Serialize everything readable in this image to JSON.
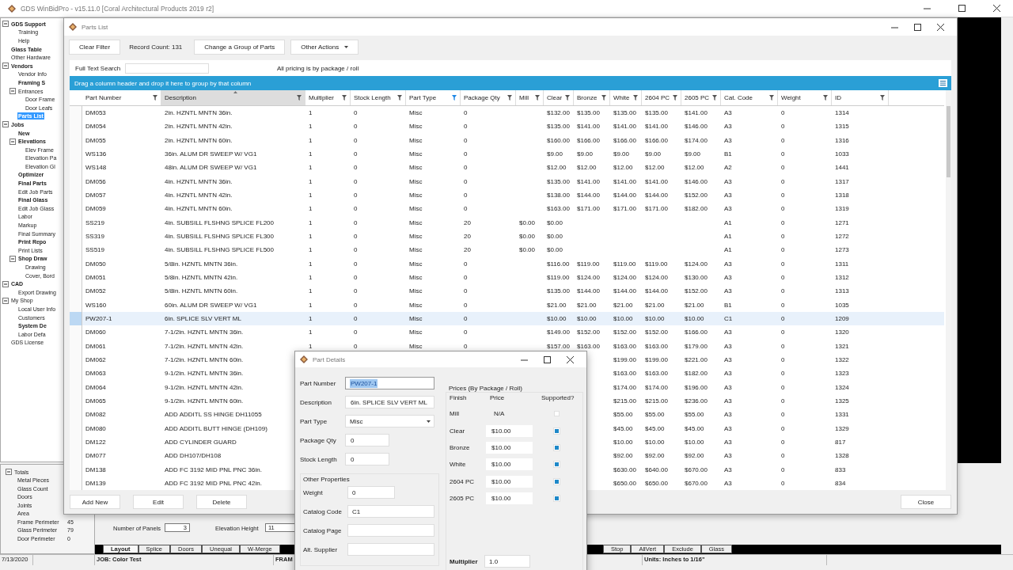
{
  "main_window": {
    "title": "GDS WinBidPro - v15.11.0 [Coral Architectural Products 2019 r2]"
  },
  "nav_tree": [
    {
      "label": "GDS Support",
      "bold": true,
      "selected": false,
      "expanded": true,
      "children": [
        {
          "label": "Training",
          "bold": false,
          "selected": false
        },
        {
          "label": "Help",
          "bold": false,
          "selected": false
        }
      ]
    },
    {
      "label": "Glass Table",
      "bold": true,
      "selected": false
    },
    {
      "label": "Other Hardware",
      "bold": false,
      "selected": false
    },
    {
      "label": "Vendors",
      "bold": true,
      "selected": false,
      "expanded": true,
      "children": [
        {
          "label": "Vendor Info",
          "bold": false,
          "selected": false
        },
        {
          "label": "Framing S",
          "bold": true,
          "selected": false
        },
        {
          "label": "Entrances",
          "bold": false,
          "selected": false,
          "expanded": true,
          "children": [
            {
              "label": "Door Frame",
              "bold": false,
              "selected": false
            },
            {
              "label": "Door Leafs",
              "bold": false,
              "selected": false
            }
          ]
        },
        {
          "label": "Parts List",
          "bold": true,
          "selected": true
        }
      ]
    },
    {
      "label": "Jobs",
      "bold": true,
      "selected": false,
      "expanded": true,
      "children": [
        {
          "label": "New",
          "bold": true,
          "selected": false
        },
        {
          "label": "Elevations",
          "bold": true,
          "selected": false,
          "expanded": true,
          "children": [
            {
              "label": "Elev Frame",
              "bold": false,
              "selected": false
            },
            {
              "label": "Elevation Pa",
              "bold": false,
              "selected": false
            },
            {
              "label": "Elevation Gl",
              "bold": false,
              "selected": false
            }
          ]
        },
        {
          "label": "Optimizer",
          "bold": true,
          "selected": false
        },
        {
          "label": "Final Parts",
          "bold": true,
          "selected": false
        },
        {
          "label": "Edit Job Parts",
          "bold": false,
          "selected": false
        },
        {
          "label": "Final Glass",
          "bold": true,
          "selected": false
        },
        {
          "label": "Edit Job Glass",
          "bold": false,
          "selected": false
        },
        {
          "label": "Labor",
          "bold": false,
          "selected": false
        },
        {
          "label": "Markup",
          "bold": false,
          "selected": false
        },
        {
          "label": "Final Summary",
          "bold": false,
          "selected": false
        },
        {
          "label": "Print Repo",
          "bold": true,
          "selected": false
        },
        {
          "label": "Print Lists",
          "bold": false,
          "selected": false
        },
        {
          "label": "Shop Draw",
          "bold": true,
          "selected": false,
          "expanded": true,
          "children": [
            {
              "label": "Drawing",
              "bold": false,
              "selected": false
            },
            {
              "label": "Cover, Bord",
              "bold": false,
              "selected": false
            }
          ]
        }
      ]
    },
    {
      "label": "CAD",
      "bold": true,
      "selected": false,
      "expanded": true,
      "children": [
        {
          "label": "Export Drawing",
          "bold": false,
          "selected": false
        }
      ]
    },
    {
      "label": "My Shop",
      "bold": false,
      "selected": false,
      "expanded": true,
      "children": [
        {
          "label": "Local User Info",
          "bold": false,
          "selected": false
        },
        {
          "label": "Customers",
          "bold": false,
          "selected": false
        },
        {
          "label": "System De",
          "bold": true,
          "selected": false
        },
        {
          "label": "Labor Defa",
          "bold": false,
          "selected": false
        }
      ]
    },
    {
      "label": "GDS License",
      "bold": false,
      "selected": false
    }
  ],
  "totals": {
    "label": "Totals",
    "expanded": true,
    "items": [
      {
        "label": "Metal Pieces"
      },
      {
        "label": "Glass Count"
      },
      {
        "label": "Doors"
      },
      {
        "label": "Joints"
      },
      {
        "label": "Area"
      },
      {
        "label": "Frame Perimeter",
        "value": "45"
      },
      {
        "label": "Glass Perimeter",
        "value": "79"
      },
      {
        "label": "Door Perimeter",
        "value": "0"
      }
    ]
  },
  "elevation_props": {
    "panels_label": "Number of Panels",
    "panels_value": "3",
    "height_label": "Elevation Height",
    "height_value": "11"
  },
  "bottom_tabs": {
    "left": [
      {
        "label": "Layout",
        "selected": true
      },
      {
        "label": "Splice",
        "selected": false
      },
      {
        "label": "Doors",
        "selected": false
      },
      {
        "label": "Unequal",
        "selected": false
      },
      {
        "label": "W-Merge",
        "selected": false
      }
    ],
    "right": [
      {
        "label": "Stop",
        "selected": false
      },
      {
        "label": "AllVert",
        "selected": false
      },
      {
        "label": "Exclude",
        "selected": false
      },
      {
        "label": "Glass",
        "selected": false
      }
    ]
  },
  "status_bar": {
    "date": "7/13/2020",
    "job": "JOB: Color Test",
    "frame": "FRAM",
    "units": "Units: Inches to 1/16\""
  },
  "parts_window": {
    "title": "Parts List",
    "toolbar": {
      "clear_filter": "Clear Filter",
      "record_count": "Record Count: 131",
      "change_group": "Change a Group of Parts",
      "other_actions": "Other Actions"
    },
    "search_label": "Full Text Search",
    "pricing_note": "All pricing is by package / roll",
    "group_hint": "Drag a column header and drop it here to group by that column",
    "columns": [
      {
        "label": "Part Number",
        "sorted": false,
        "filter_active": false
      },
      {
        "label": "Description",
        "sorted": true,
        "filter_active": false
      },
      {
        "label": "Multiplier",
        "sorted": false,
        "filter_active": false
      },
      {
        "label": "Stock Length",
        "sorted": false,
        "filter_active": false
      },
      {
        "label": "Part Type",
        "sorted": false,
        "filter_active": true
      },
      {
        "label": "Package Qty",
        "sorted": false,
        "filter_active": false
      },
      {
        "label": "Mill",
        "sorted": false,
        "filter_active": false
      },
      {
        "label": "Clear",
        "sorted": false,
        "filter_active": false
      },
      {
        "label": "Bronze",
        "sorted": false,
        "filter_active": false
      },
      {
        "label": "White",
        "sorted": false,
        "filter_active": false
      },
      {
        "label": "2604 PC",
        "sorted": false,
        "filter_active": false
      },
      {
        "label": "2605 PC",
        "sorted": false,
        "filter_active": false
      },
      {
        "label": "Cat. Code",
        "sorted": false,
        "filter_active": false
      },
      {
        "label": "Weight",
        "sorted": false,
        "filter_active": false
      },
      {
        "label": "ID",
        "sorted": false,
        "filter_active": false
      }
    ],
    "rows": [
      {
        "selected": false,
        "cells": [
          "DM053",
          "2in. HZNTL MNTN 36in.",
          "1",
          "0",
          "Misc",
          "0",
          null,
          "$132.00",
          "$135.00",
          "$135.00",
          "$135.00",
          "$141.00",
          "A3",
          "0",
          "1314"
        ]
      },
      {
        "selected": false,
        "cells": [
          "DM054",
          "2in. HZNTL MNTN 42in.",
          "1",
          "0",
          "Misc",
          "0",
          null,
          "$135.00",
          "$141.00",
          "$141.00",
          "$141.00",
          "$146.00",
          "A3",
          "0",
          "1315"
        ]
      },
      {
        "selected": false,
        "cells": [
          "DM055",
          "2in. HZNTL MNTN 60in.",
          "1",
          "0",
          "Misc",
          "0",
          null,
          "$160.00",
          "$166.00",
          "$166.00",
          "$166.00",
          "$174.00",
          "A3",
          "0",
          "1316"
        ]
      },
      {
        "selected": false,
        "cells": [
          "WS136",
          "36in. ALUM DR SWEEP W/ VG1",
          "1",
          "0",
          "Misc",
          "0",
          null,
          "$9.00",
          "$9.00",
          "$9.00",
          "$9.00",
          "$9.00",
          "B1",
          "0",
          "1033"
        ]
      },
      {
        "selected": false,
        "cells": [
          "WS148",
          "48in. ALUM DR SWEEP W/ VG1",
          "1",
          "0",
          "Misc",
          "0",
          null,
          "$12.00",
          "$12.00",
          "$12.00",
          "$12.00",
          "$12.00",
          "A2",
          "0",
          "1441"
        ]
      },
      {
        "selected": false,
        "cells": [
          "DM056",
          "4in. HZNTL MNTN 36in.",
          "1",
          "0",
          "Misc",
          "0",
          null,
          "$135.00",
          "$141.00",
          "$141.00",
          "$141.00",
          "$146.00",
          "A3",
          "0",
          "1317"
        ]
      },
      {
        "selected": false,
        "cells": [
          "DM057",
          "4in. HZNTL MNTN 42in.",
          "1",
          "0",
          "Misc",
          "0",
          null,
          "$138.00",
          "$144.00",
          "$144.00",
          "$144.00",
          "$152.00",
          "A3",
          "0",
          "1318"
        ]
      },
      {
        "selected": false,
        "cells": [
          "DM059",
          "4in. HZNTL MNTN 60in.",
          "1",
          "0",
          "Misc",
          "0",
          null,
          "$163.00",
          "$171.00",
          "$171.00",
          "$171.00",
          "$182.00",
          "A3",
          "0",
          "1319"
        ]
      },
      {
        "selected": false,
        "cells": [
          "SS219",
          "4in. SUBSILL FLSHNG SPLICE FL200",
          "1",
          "0",
          "Misc",
          "20",
          "$0.00",
          "$0.00",
          null,
          null,
          null,
          null,
          "A1",
          "0",
          "1271"
        ]
      },
      {
        "selected": false,
        "cells": [
          "SS319",
          "4in. SUBSILL FLSHNG SPLICE FL300",
          "1",
          "0",
          "Misc",
          "20",
          "$0.00",
          "$0.00",
          null,
          null,
          null,
          null,
          "A1",
          "0",
          "1272"
        ]
      },
      {
        "selected": false,
        "cells": [
          "SS519",
          "4in. SUBSILL FLSHNG SPLICE FL500",
          "1",
          "0",
          "Misc",
          "20",
          "$0.00",
          "$0.00",
          null,
          null,
          null,
          null,
          "A1",
          "0",
          "1273"
        ]
      },
      {
        "selected": false,
        "cells": [
          "DM050",
          "5/8in. HZNTL MNTN 36in.",
          "1",
          "0",
          "Misc",
          "0",
          null,
          "$116.00",
          "$119.00",
          "$119.00",
          "$119.00",
          "$124.00",
          "A3",
          "0",
          "1311"
        ]
      },
      {
        "selected": false,
        "cells": [
          "DM051",
          "5/8in. HZNTL MNTN 42in.",
          "1",
          "0",
          "Misc",
          "0",
          null,
          "$119.00",
          "$124.00",
          "$124.00",
          "$124.00",
          "$130.00",
          "A3",
          "0",
          "1312"
        ]
      },
      {
        "selected": false,
        "cells": [
          "DM052",
          "5/8in. HZNTL MNTN 60in.",
          "1",
          "0",
          "Misc",
          "0",
          null,
          "$135.00",
          "$144.00",
          "$144.00",
          "$144.00",
          "$152.00",
          "A3",
          "0",
          "1313"
        ]
      },
      {
        "selected": false,
        "cells": [
          "WS160",
          "60in. ALUM DR SWEEP W/ VG1",
          "1",
          "0",
          "Misc",
          "0",
          null,
          "$21.00",
          "$21.00",
          "$21.00",
          "$21.00",
          "$21.00",
          "B1",
          "0",
          "1035"
        ]
      },
      {
        "selected": true,
        "cells": [
          "PW207-1",
          "6in. SPLICE SLV VERT ML",
          "1",
          "0",
          "Misc",
          "0",
          null,
          "$10.00",
          "$10.00",
          "$10.00",
          "$10.00",
          "$10.00",
          "C1",
          "0",
          "1209"
        ]
      },
      {
        "selected": false,
        "cells": [
          "DM060",
          "7-1/2in. HZNTL MNTN 36in.",
          "1",
          "0",
          "Misc",
          "0",
          null,
          "$149.00",
          "$152.00",
          "$152.00",
          "$152.00",
          "$166.00",
          "A3",
          "0",
          "1320"
        ]
      },
      {
        "selected": false,
        "cells": [
          "DM061",
          "7-1/2in. HZNTL MNTN 42in.",
          "1",
          "0",
          "Misc",
          "0",
          null,
          "$157.00",
          "$163.00",
          "$163.00",
          "$163.00",
          "$179.00",
          "A3",
          "0",
          "1321"
        ]
      },
      {
        "selected": false,
        "cells": [
          "DM062",
          "7-1/2in. HZNTL MNTN 60in.",
          null,
          null,
          null,
          null,
          null,
          null,
          null,
          "$199.00",
          "$199.00",
          "$221.00",
          "A3",
          "0",
          "1322"
        ]
      },
      {
        "selected": false,
        "cells": [
          "DM063",
          "9-1/2in. HZNTL MNTN 36in.",
          null,
          null,
          null,
          null,
          null,
          null,
          null,
          "$163.00",
          "$163.00",
          "$182.00",
          "A3",
          "0",
          "1323"
        ]
      },
      {
        "selected": false,
        "cells": [
          "DM064",
          "9-1/2in. HZNTL MNTN 42in.",
          null,
          null,
          null,
          null,
          null,
          null,
          null,
          "$174.00",
          "$174.00",
          "$196.00",
          "A3",
          "0",
          "1324"
        ]
      },
      {
        "selected": false,
        "cells": [
          "DM065",
          "9-1/2in. HZNTL MNTN 60in.",
          null,
          null,
          null,
          null,
          null,
          null,
          null,
          "$215.00",
          "$215.00",
          "$236.00",
          "A3",
          "0",
          "1325"
        ]
      },
      {
        "selected": false,
        "cells": [
          "DM082",
          "ADD ADDITL SS HINGE DH11055",
          null,
          null,
          null,
          null,
          null,
          null,
          null,
          "$55.00",
          "$55.00",
          "$55.00",
          "A3",
          "0",
          "1331"
        ]
      },
      {
        "selected": false,
        "cells": [
          "DM080",
          "ADD ADDITL BUTT HINGE (DH109)",
          null,
          null,
          null,
          null,
          null,
          null,
          null,
          "$45.00",
          "$45.00",
          "$45.00",
          "A3",
          "0",
          "1329"
        ]
      },
      {
        "selected": false,
        "cells": [
          "DM122",
          "ADD CYLINDER GUARD",
          null,
          null,
          null,
          null,
          null,
          null,
          null,
          "$10.00",
          "$10.00",
          "$10.00",
          "A3",
          "0",
          "817"
        ]
      },
      {
        "selected": false,
        "cells": [
          "DM077",
          "ADD DH107/DH108",
          null,
          null,
          null,
          null,
          null,
          null,
          null,
          "$92.00",
          "$92.00",
          "$92.00",
          "A3",
          "0",
          "1328"
        ]
      },
      {
        "selected": false,
        "cells": [
          "DM138",
          "ADD FC 3192 MID PNL PNC 36in.",
          null,
          null,
          null,
          null,
          null,
          null,
          null,
          "$630.00",
          "$640.00",
          "$670.00",
          "A3",
          "0",
          "833"
        ]
      },
      {
        "selected": false,
        "cells": [
          "DM139",
          "ADD FC 3192 MID PNL PNC 42in.",
          null,
          null,
          null,
          null,
          null,
          null,
          null,
          "$650.00",
          "$650.00",
          "$670.00",
          "A3",
          "0",
          "834"
        ]
      }
    ],
    "buttons": {
      "add": "Add New",
      "edit": "Edit",
      "delete": "Delete",
      "close": "Close"
    }
  },
  "part_details": {
    "title": "Part Details",
    "fields": [
      {
        "label": "Part Number",
        "value": "PW207-1",
        "kind": "text",
        "value_selected": true
      },
      {
        "label": "Description",
        "value": "6in. SPLICE SLV VERT ML",
        "kind": "text",
        "value_selected": false
      },
      {
        "label": "Part Type",
        "value": "Misc",
        "kind": "dropdown"
      },
      {
        "label": "Package Qty",
        "value": "0",
        "kind": "short",
        "value_selected": false
      },
      {
        "label": "Stock Length",
        "value": "0",
        "kind": "short",
        "value_selected": false
      }
    ],
    "other_properties": {
      "title": "Other Properties",
      "fields": [
        {
          "label": "Weight",
          "value": "0",
          "kind": "short"
        },
        {
          "label": "Catalog Code",
          "value": "C1",
          "kind": "text"
        },
        {
          "label": "Catalog Page",
          "kind": "text"
        },
        {
          "label": "Alt. Supplier",
          "kind": "text"
        }
      ]
    },
    "prices": {
      "title": "Prices (By Package / Roll)",
      "headers": [
        "Finish",
        "Price",
        "Supported?"
      ],
      "finishes": [
        {
          "finish": "Mill",
          "price": "N/A",
          "kind": "text",
          "supported": false
        },
        {
          "finish": "Clear",
          "price": "$10.00",
          "kind": "field",
          "supported": true
        },
        {
          "finish": "Bronze",
          "price": "$10.00",
          "kind": "field",
          "supported": true
        },
        {
          "finish": "White",
          "price": "$10.00",
          "kind": "field",
          "supported": true
        },
        {
          "finish": "2604 PC",
          "price": "$10.00",
          "kind": "field",
          "supported": true
        },
        {
          "finish": "2605 PC",
          "price": "$10.00",
          "kind": "field",
          "supported": true
        }
      ],
      "multiplier_label": "Multiplier",
      "multiplier_value": "1.0"
    }
  }
}
